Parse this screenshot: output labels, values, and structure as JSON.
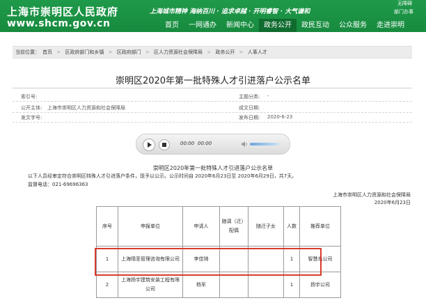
{
  "header": {
    "site_name": "上海市崇明区人民政府",
    "site_url": "www.shcm.gov.cn",
    "slogan": "上海城市精神  海纳百川 · 追求卓越 · 开明睿智 · 大气谦和",
    "top_link_1": "无障碍",
    "top_util": "部门办事",
    "nav": [
      {
        "label": "首页"
      },
      {
        "label": "一网通办"
      },
      {
        "label": "新闻中心"
      },
      {
        "label": "政务公开"
      },
      {
        "label": "政民互动"
      },
      {
        "label": "公众服务"
      },
      {
        "label": "走进崇明"
      }
    ]
  },
  "breadcrumb": {
    "prefix": "当前位置：",
    "items": [
      "首页",
      "区政府部门和乡镇",
      "区政府部门",
      "区人力资源社会保障局",
      "政务公开",
      "人事人才"
    ]
  },
  "article": {
    "title": "崇明区2020年第一批特殊人才引进落户公示名单",
    "meta": {
      "index_label": "索引号:",
      "index_value": "",
      "topic_label": "主题分类:",
      "topic_value": "-",
      "publisher_label": "公开主体:",
      "publisher_value": "上海市崇明区人力资源和社会保障局",
      "created_label": "成文日期:",
      "created_value": "",
      "docno_label": "发文字号:",
      "docno_value": "",
      "published_label": "发布日期:",
      "published_value": "2020-6-23"
    },
    "player": {
      "current_time": "00:00",
      "total_time": "00:00"
    },
    "notice": {
      "heading": "崇明区2020年第一批特殊人才引进落户公示名单",
      "paragraph": "以下人员经审定符合崇明区特殊人才引进落户条件，现予以公示。公示时间自 2020年6月23日至 2020年6月29日，共7天。",
      "phone": "监督电话：021-69696363",
      "issuer": "上海市崇明区人力资源和社会保障局",
      "date": "2020年6月23日"
    },
    "table": {
      "headers": [
        "序号",
        "申报单位",
        "申请人",
        "随调（迁）配偶",
        "随迁子女",
        "人数",
        "推荐单位"
      ],
      "rows": [
        [
          "1",
          "上海晴圣管理咨询有限公司",
          "李佳琦",
          "",
          "",
          "1",
          "智慧岛公司"
        ],
        [
          "2",
          "上海扬宇建筑安装工程有限公司",
          "杨军",
          "",
          "",
          "1",
          "扬宇公司"
        ]
      ]
    }
  },
  "colors": {
    "header_green": "#1f9a4a",
    "nav_active": "#0f6b2e",
    "highlight_red": "#d93a2b"
  }
}
